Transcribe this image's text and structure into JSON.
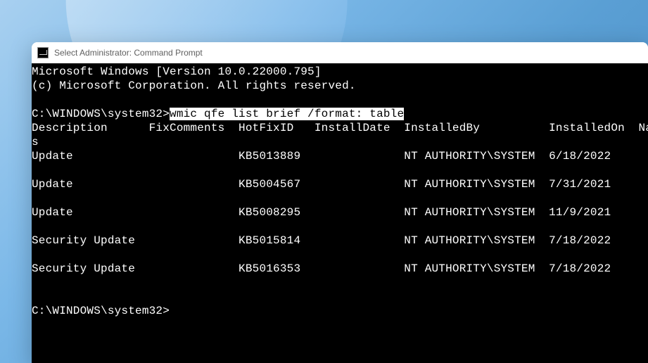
{
  "wallpaper": {
    "name": "windows-11-bloom"
  },
  "window": {
    "title": "Select Administrator: Command Prompt",
    "icon_name": "cmd-icon"
  },
  "terminal": {
    "banner_line1": "Microsoft Windows [Version 10.0.22000.795]",
    "banner_line2": "(c) Microsoft Corporation. All rights reserved.",
    "prompt1_cwd": "C:\\WINDOWS\\system32>",
    "prompt1_cmd": "wmic qfe list brief /format: table",
    "columns_line": "Description      FixComments  HotFixID   InstallDate  InstalledBy          InstalledOn  Name  Ser",
    "columns_line2": "s",
    "rows": [
      {
        "desc": "Update",
        "hotfix": "KB5013889",
        "by": "NT AUTHORITY\\SYSTEM",
        "on": "6/18/2022"
      },
      {
        "desc": "Update",
        "hotfix": "KB5004567",
        "by": "NT AUTHORITY\\SYSTEM",
        "on": "7/31/2021"
      },
      {
        "desc": "Update",
        "hotfix": "KB5008295",
        "by": "NT AUTHORITY\\SYSTEM",
        "on": "11/9/2021"
      },
      {
        "desc": "Security Update",
        "hotfix": "KB5015814",
        "by": "NT AUTHORITY\\SYSTEM",
        "on": "7/18/2022"
      },
      {
        "desc": "Security Update",
        "hotfix": "KB5016353",
        "by": "NT AUTHORITY\\SYSTEM",
        "on": "7/18/2022"
      }
    ],
    "prompt2_cwd": "C:\\WINDOWS\\system32>",
    "prompt2_input": ""
  }
}
